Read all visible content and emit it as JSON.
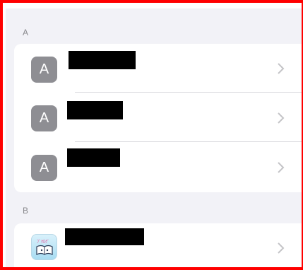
{
  "sections": [
    {
      "header": "A",
      "rows": [
        {
          "icon_letter": "A",
          "icon": "letter-a-icon",
          "name": "",
          "redacted": true
        },
        {
          "icon_letter": "A",
          "icon": "letter-a-icon",
          "name": "",
          "redacted": true
        },
        {
          "icon_letter": "A",
          "icon": "letter-a-icon",
          "name": "",
          "redacted": true
        }
      ]
    },
    {
      "header": "B",
      "rows": [
        {
          "icon": "book-app-icon",
          "name": "",
          "redacted": true
        }
      ]
    }
  ],
  "chevron_icon": "chevron-right-icon",
  "colors": {
    "screenshot_border": "#ff0000",
    "list_background": "#f2f2f7",
    "placeholder_icon": "#8e8e93",
    "chevron": "#c4c4c7"
  }
}
